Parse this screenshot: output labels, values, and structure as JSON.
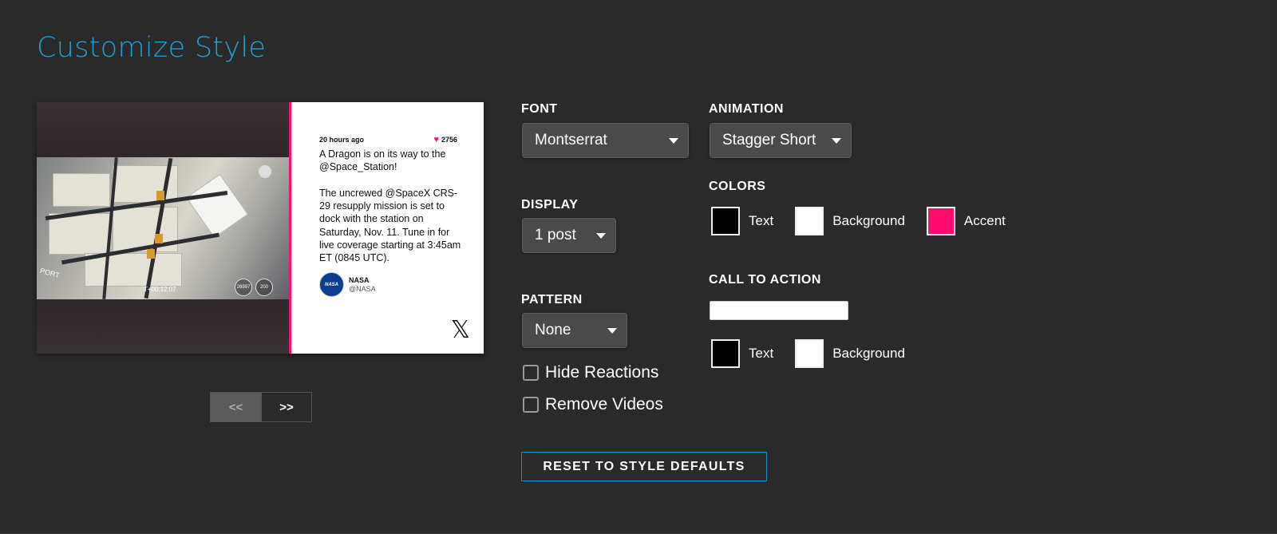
{
  "page": {
    "title": "Customize Style"
  },
  "preview": {
    "post": {
      "time": "20 hours ago",
      "likes": "2756",
      "text": "A Dragon is on its way to the @Space_Station!\n\nThe uncrewed @SpaceX CRS-29 resupply mission is set to dock with the station on Saturday, Nov. 11. Tune in for live coverage starting at 3:45am ET (0845 UTC).",
      "author_name": "NASA",
      "author_handle": "@NASA",
      "avatar_text": "NASA",
      "platform_icon": "x-logo-icon"
    },
    "media": {
      "timecode": "T+00:12:07",
      "gauge_left": "26997",
      "gauge_right": "200",
      "port_label": "PORT"
    },
    "accent_color": "#ff0d6e"
  },
  "pager": {
    "prev_label": "<<",
    "next_label": ">>"
  },
  "font": {
    "label": "FONT",
    "value": "Montserrat"
  },
  "display": {
    "label": "DISPLAY",
    "value": "1 post"
  },
  "pattern": {
    "label": "PATTERN",
    "value": "None"
  },
  "animation": {
    "label": "ANIMATION",
    "value": "Stagger Short"
  },
  "options": {
    "hide_reactions": {
      "label": "Hide Reactions",
      "checked": false
    },
    "remove_videos": {
      "label": "Remove Videos",
      "checked": false
    }
  },
  "colors": {
    "label": "COLORS",
    "text": {
      "label": "Text",
      "color": "#000000"
    },
    "background": {
      "label": "Background",
      "color": "#ffffff"
    },
    "accent": {
      "label": "Accent",
      "color": "#ff0d6e"
    }
  },
  "cta": {
    "label": "CALL TO ACTION",
    "input_value": "",
    "text": {
      "label": "Text",
      "color": "#000000"
    },
    "background": {
      "label": "Background",
      "color": "#ffffff"
    }
  },
  "reset": {
    "label": "RESET TO STYLE DEFAULTS"
  },
  "theme": {
    "title_color": "#1da0d8",
    "bg": "#2a2a2a",
    "button_border": "#1a8fc0"
  }
}
